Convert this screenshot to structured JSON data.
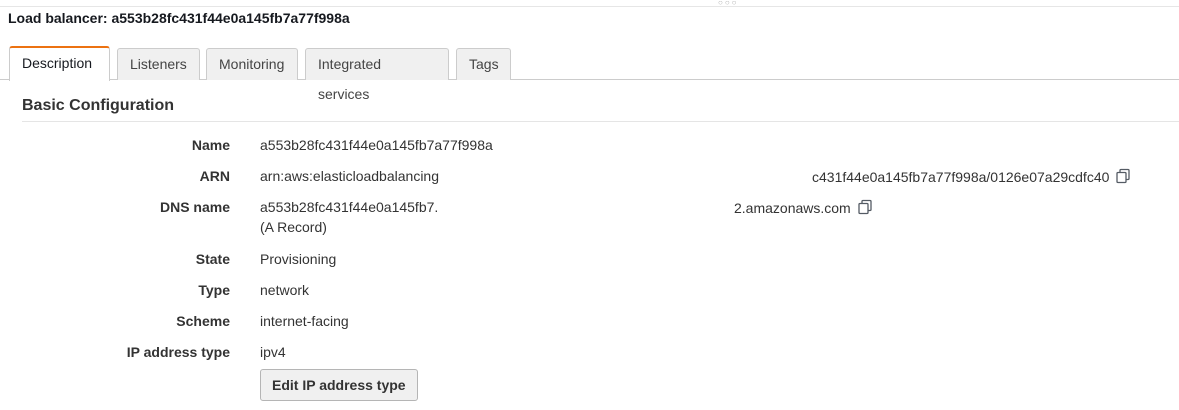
{
  "header": {
    "title": "Load balancer: a553b28fc431f44e0a145fb7a77f998a"
  },
  "tabs": [
    {
      "label": "Description",
      "active": true
    },
    {
      "label": "Listeners",
      "active": false
    },
    {
      "label": "Monitoring",
      "active": false
    },
    {
      "label": "Integrated services",
      "active": false
    },
    {
      "label": "Tags",
      "active": false
    }
  ],
  "section": {
    "title": "Basic Configuration"
  },
  "fields": {
    "name": {
      "label": "Name",
      "value": "a553b28fc431f44e0a145fb7a77f998a"
    },
    "arn": {
      "label": "ARN",
      "value_left": "arn:aws:elasticloadbalancing",
      "value_right": "c431f44e0a145fb7a77f998a/0126e07a29cdfc40"
    },
    "dns": {
      "label": "DNS name",
      "value_left": "a553b28fc431f44e0a145fb7.",
      "value_right": "2.amazonaws.com",
      "note": "(A Record)"
    },
    "state": {
      "label": "State",
      "value": "Provisioning"
    },
    "type": {
      "label": "Type",
      "value": "network"
    },
    "scheme": {
      "label": "Scheme",
      "value": "internet-facing"
    },
    "ip_address_type": {
      "label": "IP address type",
      "value": "ipv4"
    }
  },
  "actions": {
    "edit_ip_label": "Edit IP address type"
  },
  "icons": {
    "copy": "copy-icon"
  },
  "colors": {
    "active_tab_accent": "#ec7211",
    "tab_background": "#f0f0f0"
  }
}
